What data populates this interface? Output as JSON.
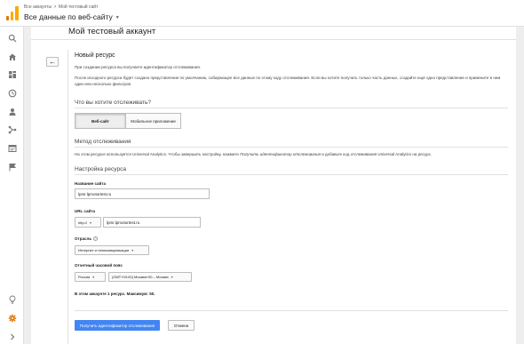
{
  "header": {
    "breadcrumb": [
      "Все аккаунты",
      "Мой тестовый сайт"
    ],
    "breadcrumb_separator": ">",
    "view_selector": "Все данные по веб-сайту"
  },
  "rail": {
    "items": [
      {
        "icon": "search-icon",
        "active": false
      },
      {
        "icon": "home-icon",
        "active": false
      },
      {
        "icon": "dashboard-icon",
        "active": false
      },
      {
        "icon": "clock-icon",
        "active": false
      },
      {
        "icon": "person-icon",
        "active": false
      },
      {
        "icon": "acquisition-icon",
        "active": false
      },
      {
        "icon": "behavior-icon",
        "active": false
      },
      {
        "icon": "flag-icon",
        "active": false
      },
      {
        "icon": "lightbulb-icon",
        "active": false
      },
      {
        "icon": "gear-icon",
        "active": true
      },
      {
        "icon": "chevron-right-icon",
        "active": false
      }
    ],
    "active_color": "#e37400",
    "icon_color": "#757575"
  },
  "account": {
    "title": "Мой тестовый аккаунт"
  },
  "form": {
    "heading": "Новый ресурс",
    "intro": "При создании ресурса вы получаете идентификатор отслеживания.",
    "description": "После исходного ресурса будет создано представление по умолчанию, собирающее все данные по этому коду отслеживания. Если вы хотите получать только часть данных, создайте ещё одно представление и примените в нем один или несколько фильтров.",
    "track_question": "Что вы хотите отслеживать?",
    "track_options": [
      "Веб-сайт",
      "Мобильное приложение"
    ],
    "track_selected": "Веб-сайт",
    "method_heading": "Метод отслеживания",
    "method_text_before": "На этом ресурсе используется Universal Analytics. Чтобы завершить настройку, нажмите ",
    "method_text_italic": "Получить идентификатор отслеживания",
    "method_text_after": " и добавьте код отслеживания Universal Analytics на ресурс.",
    "setup_heading": "Настройка ресурса",
    "site_name_label": "Название сайта",
    "site_name_value": "lpmr.lpmotortest.ru",
    "site_url_label": "URL сайта",
    "protocol_value": "http://",
    "site_url_value": "lpmr.lpmotortest.ru",
    "industry_label": "Отрасль",
    "industry_value": "Интернет и телекоммуникации",
    "timezone_label": "Отчетный часовой пояс",
    "country_value": "Россия",
    "timezone_value": "(GMT+03:00) Москва+00 – Москва",
    "limit_text": "В этом аккаунте 1 ресурс. Максимум: 50.",
    "submit_label": "Получить идентификатор отслеживания",
    "cancel_label": "Отмена",
    "accent_color": "#4285f4"
  }
}
